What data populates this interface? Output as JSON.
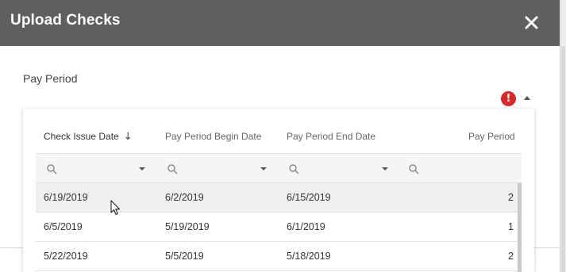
{
  "dialog": {
    "title": "Upload Checks",
    "close_icon": "close-icon"
  },
  "pay_period_field": {
    "label": "Pay Period",
    "error_icon": "error-icon",
    "error_glyph": "!",
    "dropdown_icon": "caret-up-icon"
  },
  "grid": {
    "columns": [
      {
        "label": "Check Issue Date",
        "sort_icon": "arrow-down-icon",
        "sort_glyph": "↓"
      },
      {
        "label": "Pay Period Begin Date"
      },
      {
        "label": "Pay Period End Date"
      },
      {
        "label": "Pay Period"
      }
    ],
    "filter_icons": [
      "search-icon",
      "dropdown-arrow-icon"
    ],
    "rows": [
      {
        "check_issue_date": "6/19/2019",
        "begin_date": "6/2/2019",
        "end_date": "6/15/2019",
        "pay_period": "2"
      },
      {
        "check_issue_date": "6/5/2019",
        "begin_date": "5/19/2019",
        "end_date": "6/1/2019",
        "pay_period": "1"
      },
      {
        "check_issue_date": "5/22/2019",
        "begin_date": "5/5/2019",
        "end_date": "5/18/2019",
        "pay_period": "2"
      }
    ],
    "selected_row": 0
  },
  "colors": {
    "titlebar": "#5f5f5f",
    "error": "#d62b2b",
    "selected_row": "#f0f0f0"
  }
}
